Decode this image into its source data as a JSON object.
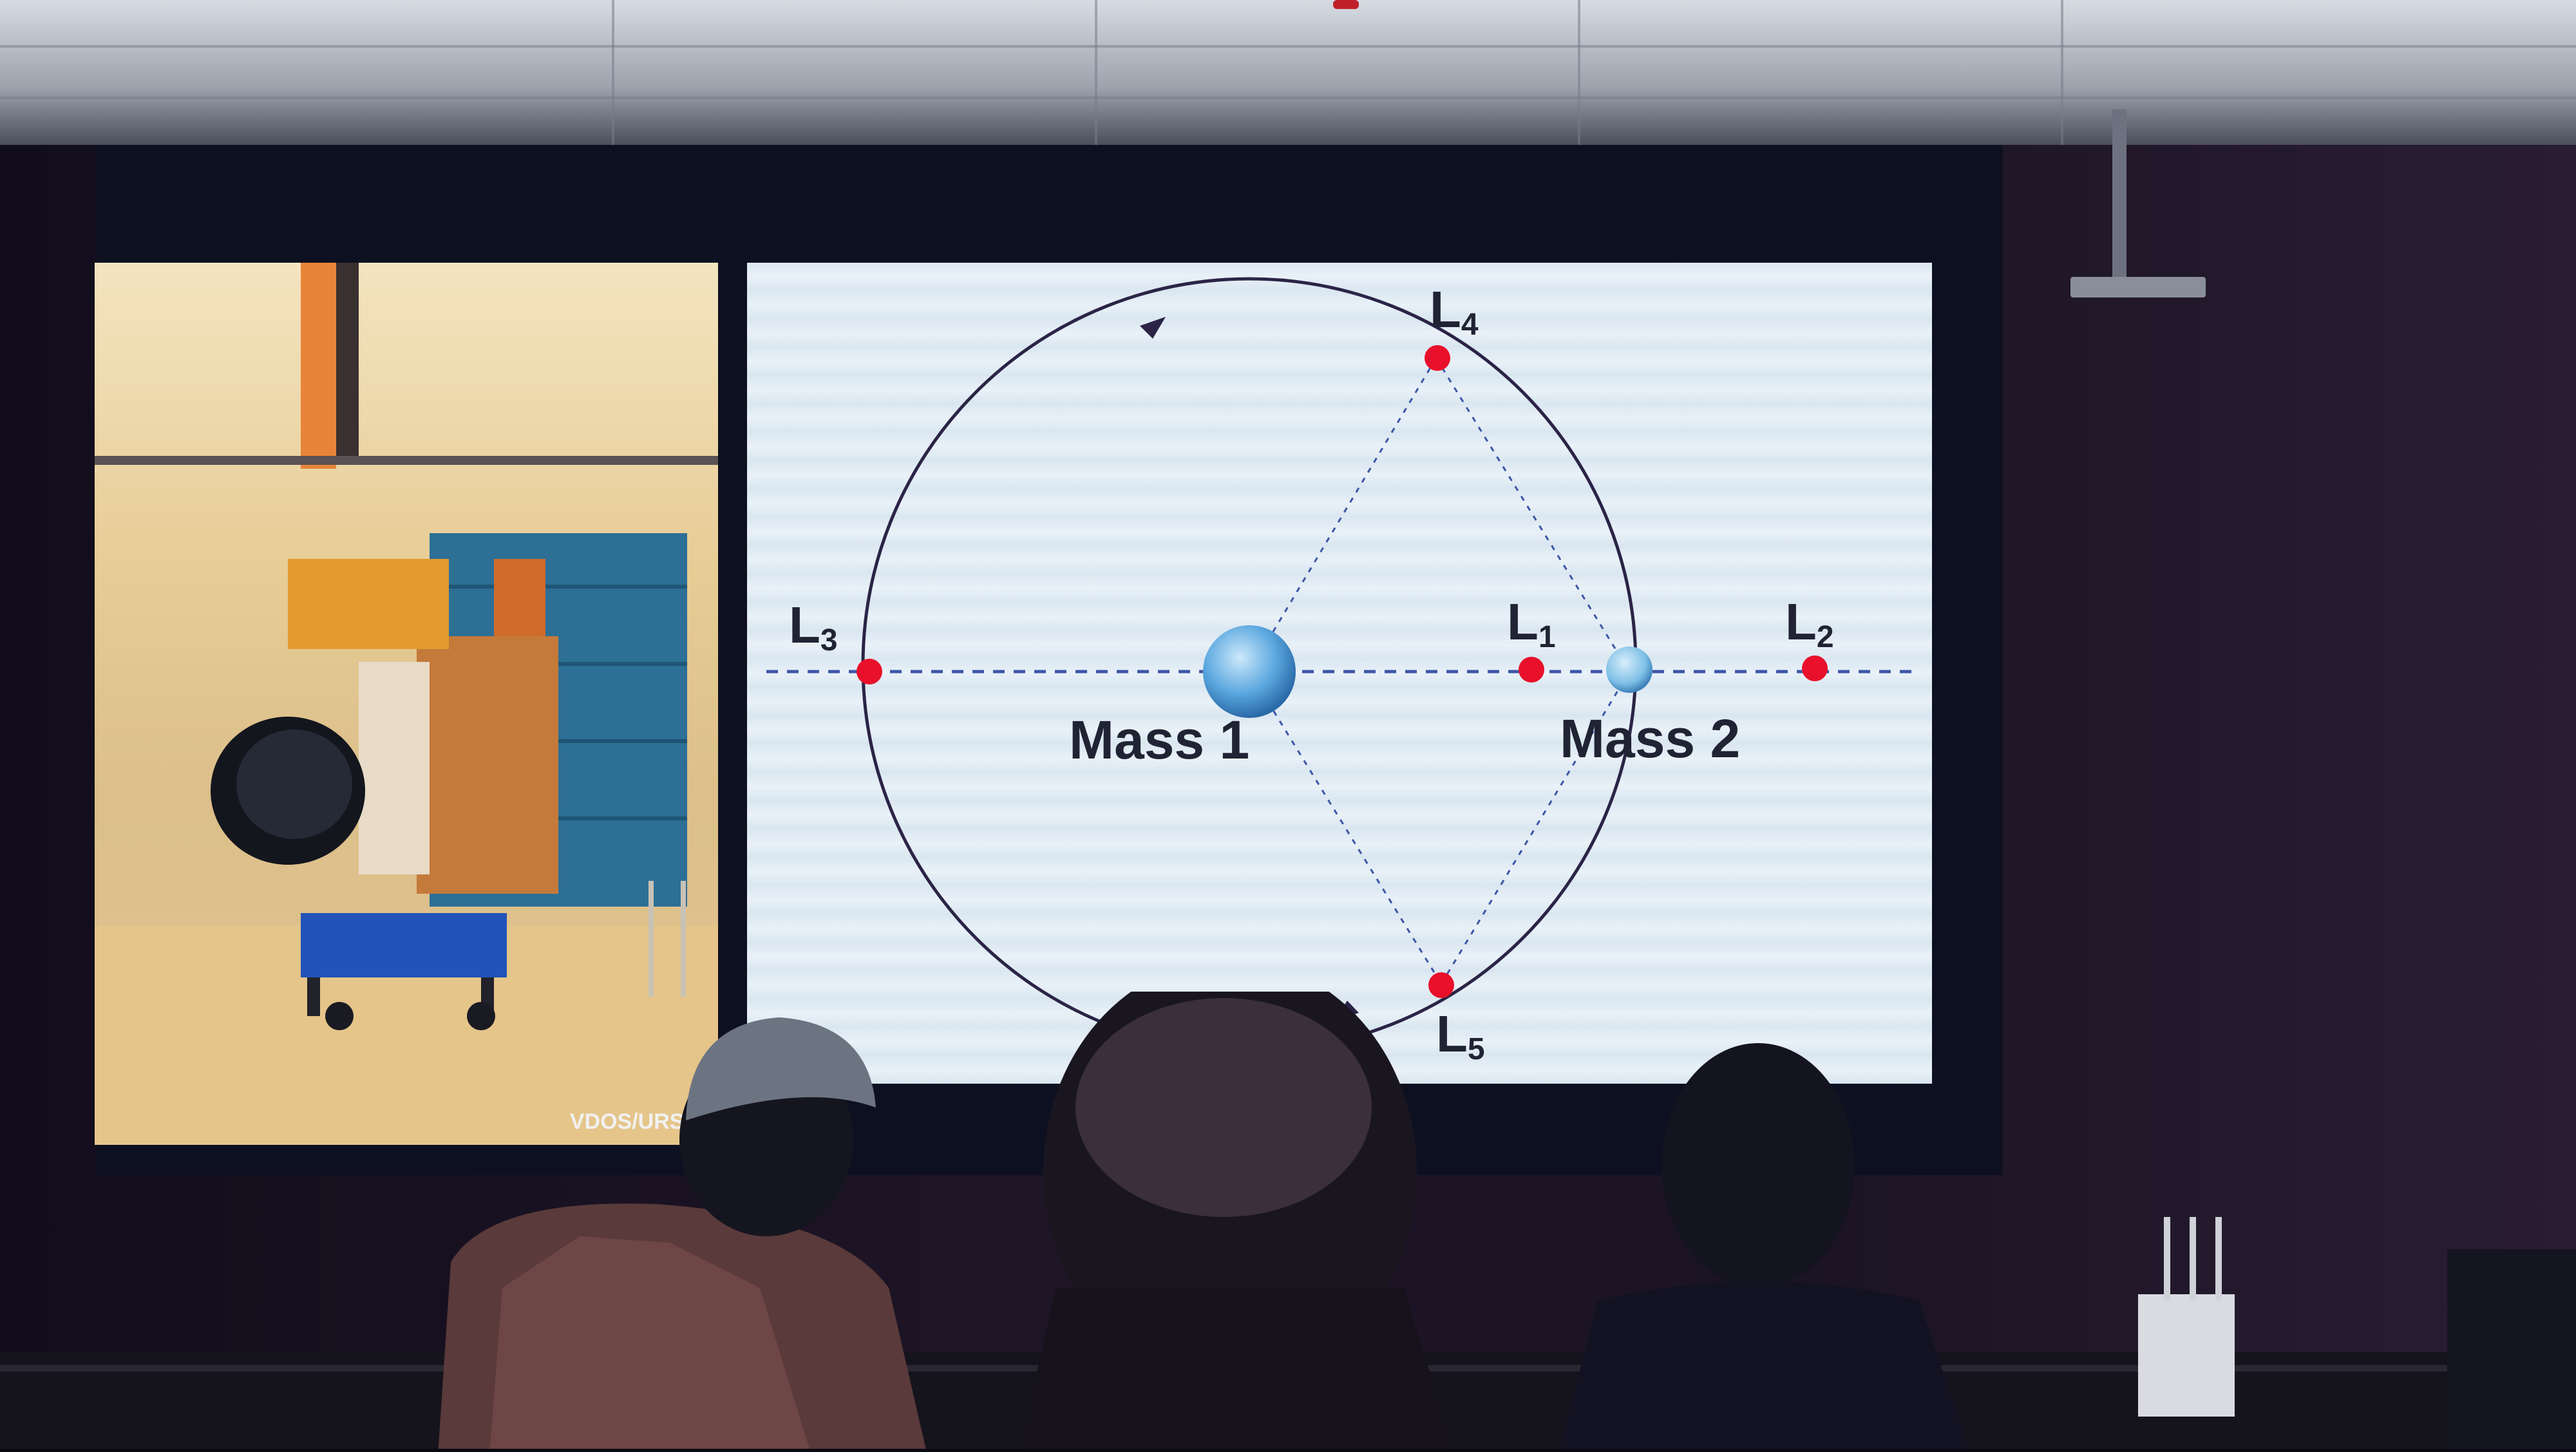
{
  "slide": {
    "diagram": {
      "labels": {
        "l1": "L",
        "l1_sub": "1",
        "l2": "L",
        "l2_sub": "2",
        "l3": "L",
        "l3_sub": "3",
        "l4": "L",
        "l4_sub": "4",
        "l5": "L",
        "l5_sub": "5",
        "mass1": "Mass 1",
        "mass2": "Mass 2"
      },
      "colors": {
        "lagrange_point": "#e8102a",
        "orbit": "#2b2446",
        "guide_lines": "#3d56a8",
        "mass": "#5aa7df"
      }
    },
    "photo": {
      "credit": "VDOS/URSC"
    }
  }
}
